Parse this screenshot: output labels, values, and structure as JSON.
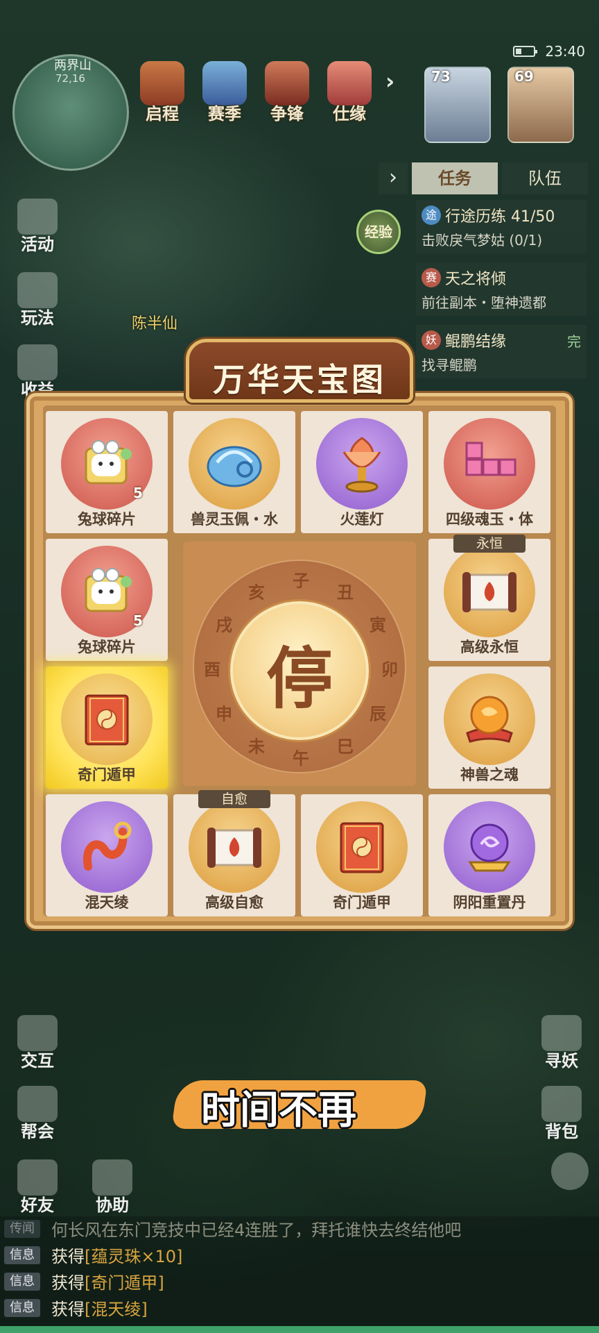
{
  "status": {
    "time": "23:40"
  },
  "map": {
    "name": "两界山",
    "coords": "72,16"
  },
  "top_menu": [
    {
      "label": "启程",
      "icon": "scroll-icon"
    },
    {
      "label": "赛季",
      "icon": "season-icon"
    },
    {
      "label": "争锋",
      "icon": "battle-icon"
    },
    {
      "label": "仕缘",
      "icon": "career-icon"
    }
  ],
  "portraits": [
    {
      "level": "73",
      "icon": "white-beast-portrait"
    },
    {
      "level": "69",
      "icon": "hero-portrait"
    }
  ],
  "quest_panel": {
    "tabs": [
      "任务",
      "队伍"
    ],
    "exp_label": "经验",
    "quests": [
      {
        "badge": "途",
        "title": "行途历练 41/50",
        "desc": "击败戾气梦姑 (0/1)"
      },
      {
        "badge": "赛",
        "title": "天之将倾",
        "desc": "前往副本・堕神遗都"
      },
      {
        "badge": "妖",
        "title": "鲲鹏结缘",
        "desc": "找寻鲲鹏"
      }
    ],
    "complete_mark": "完"
  },
  "npc_name": "陈半仙",
  "left_menu": [
    "活动",
    "玩法",
    "收益"
  ],
  "left_menu_bottom": [
    "交互",
    "帮会",
    "好友",
    "协助"
  ],
  "right_menu_bottom": [
    "寻妖",
    "背包"
  ],
  "board": {
    "title": "万华天宝图",
    "stop_label": "停",
    "dial_chars": [
      "子",
      "丑",
      "寅",
      "卯",
      "辰",
      "巳",
      "午",
      "未",
      "申",
      "酉",
      "戌",
      "亥"
    ],
    "cells": [
      {
        "name": "兔球碎片",
        "qty": "5",
        "disc": "red",
        "icon": "puzzle-piece-icon"
      },
      {
        "name": "兽灵玉佩・水",
        "disc": "gold",
        "icon": "jade-pendant-icon"
      },
      {
        "name": "火莲灯",
        "disc": "purple",
        "icon": "lotus-lamp-icon"
      },
      {
        "name": "四级魂玉・体",
        "disc": "red",
        "icon": "soul-jade-icon"
      },
      {
        "name": "兔球碎片",
        "qty": "5",
        "disc": "red",
        "icon": "puzzle-piece-icon"
      },
      {
        "name": "高级永恒",
        "tag": "永恒",
        "disc": "gold",
        "icon": "skill-scroll-icon"
      },
      {
        "name": "奇门遁甲",
        "disc": "gold",
        "icon": "skill-book-icon",
        "highlighted": true
      },
      {
        "name": "神兽之魂",
        "disc": "gold",
        "icon": "beast-soul-orb-icon"
      },
      {
        "name": "混天绫",
        "disc": "purple",
        "icon": "sash-icon"
      },
      {
        "name": "高级自愈",
        "tag": "自愈",
        "disc": "gold",
        "icon": "skill-scroll-icon"
      },
      {
        "name": "奇门遁甲",
        "disc": "gold",
        "icon": "skill-book-icon"
      },
      {
        "name": "阴阳重置丹",
        "disc": "purple",
        "icon": "pill-orb-icon"
      }
    ]
  },
  "subtitle": "时间不再",
  "chat": [
    {
      "tag": "传闻",
      "text": "何长风在东门竞技中已经4连胜了，拜托谁快去终结他吧"
    },
    {
      "tag": "信息",
      "prefix": "获得",
      "item": "[蕴灵珠×10]"
    },
    {
      "tag": "信息",
      "prefix": "获得",
      "item": "[奇门遁甲]"
    },
    {
      "tag": "信息",
      "prefix": "获得",
      "item": "[混天绫]"
    }
  ]
}
